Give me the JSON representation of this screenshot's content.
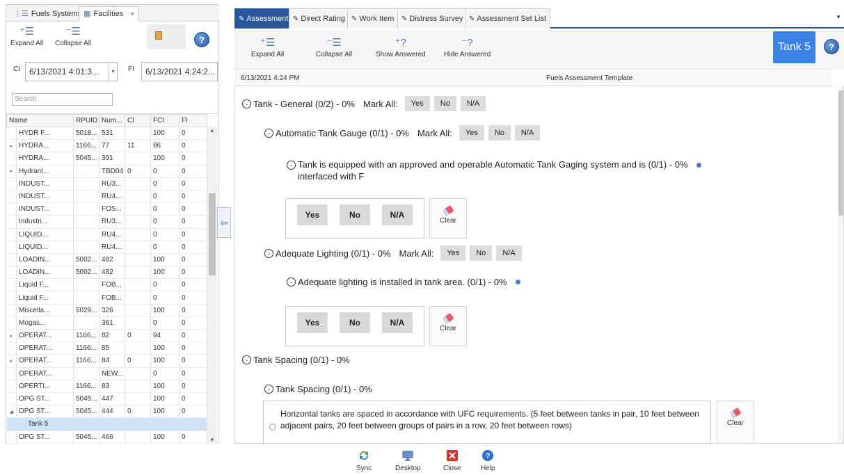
{
  "left_panel": {
    "tabs": [
      {
        "label": "Fuels Systems",
        "icon": "tree-icon"
      },
      {
        "label": "Facilities",
        "icon": "facility-icon",
        "close": "×"
      }
    ],
    "toolbar": {
      "expand_all": "Expand All",
      "collapse_all": "Collapse All"
    },
    "ci_label": "CI",
    "ci_value": "6/13/2021 4:01:3...",
    "fi_label": "FI",
    "fi_value": "6/13/2021 4:24:2...",
    "search_placeholder": "Search",
    "columns": [
      "Name",
      "RPUID",
      "Num...",
      "CI",
      "FCI",
      "FI"
    ],
    "rows": [
      {
        "exp": "",
        "name": "HYDR F...",
        "rpuid": "5018...",
        "num": "531",
        "ci": "",
        "fci": "100",
        "fi": "0"
      },
      {
        "exp": "▸",
        "name": "HYDRA...",
        "rpuid": "1166...",
        "num": "77",
        "ci": "11",
        "fci": "86",
        "fi": "0"
      },
      {
        "exp": "",
        "name": "HYDRA...",
        "rpuid": "5045...",
        "num": "391",
        "ci": "",
        "fci": "100",
        "fi": "0"
      },
      {
        "exp": "▸",
        "name": "Hydrant...",
        "rpuid": "",
        "num": "TBD04",
        "ci": "0",
        "fci": "0",
        "fi": "0"
      },
      {
        "exp": "",
        "name": "INDUST...",
        "rpuid": "",
        "num": "RU3...",
        "ci": "",
        "fci": "0",
        "fi": "0"
      },
      {
        "exp": "",
        "name": "INDUST...",
        "rpuid": "",
        "num": "RU4...",
        "ci": "",
        "fci": "0",
        "fi": "0"
      },
      {
        "exp": "",
        "name": "INDUST...",
        "rpuid": "",
        "num": "FOS...",
        "ci": "",
        "fci": "0",
        "fi": "0"
      },
      {
        "exp": "",
        "name": "Industri...",
        "rpuid": "",
        "num": "RU3...",
        "ci": "",
        "fci": "0",
        "fi": "0"
      },
      {
        "exp": "",
        "name": "LIQUID...",
        "rpuid": "",
        "num": "RU4...",
        "ci": "",
        "fci": "0",
        "fi": "0"
      },
      {
        "exp": "",
        "name": "LIQUID...",
        "rpuid": "",
        "num": "RU4...",
        "ci": "",
        "fci": "0",
        "fi": "0"
      },
      {
        "exp": "",
        "name": "LOADIN...",
        "rpuid": "5002...",
        "num": "482",
        "ci": "",
        "fci": "100",
        "fi": "0"
      },
      {
        "exp": "",
        "name": "LOADIN...",
        "rpuid": "5002...",
        "num": "482",
        "ci": "",
        "fci": "100",
        "fi": "0"
      },
      {
        "exp": "",
        "name": "Liquid F...",
        "rpuid": "",
        "num": "FOB...",
        "ci": "",
        "fci": "0",
        "fi": "0"
      },
      {
        "exp": "",
        "name": "Liquid F...",
        "rpuid": "",
        "num": "FOB...",
        "ci": "",
        "fci": "0",
        "fi": "0"
      },
      {
        "exp": "",
        "name": "Miscella...",
        "rpuid": "5029...",
        "num": "326",
        "ci": "",
        "fci": "100",
        "fi": "0"
      },
      {
        "exp": "",
        "name": "Mogas...",
        "rpuid": "",
        "num": "361",
        "ci": "",
        "fci": "0",
        "fi": "0"
      },
      {
        "exp": "▸",
        "name": "OPERAT...",
        "rpuid": "1166...",
        "num": "82",
        "ci": "0",
        "fci": "94",
        "fi": "0"
      },
      {
        "exp": "",
        "name": "OPERAT...",
        "rpuid": "1166...",
        "num": "85",
        "ci": "",
        "fci": "100",
        "fi": "0"
      },
      {
        "exp": "▸",
        "name": "OPERAT...",
        "rpuid": "1166...",
        "num": "84",
        "ci": "0",
        "fci": "100",
        "fi": "0"
      },
      {
        "exp": "",
        "name": "OPERAT...",
        "rpuid": "",
        "num": "NEW...",
        "ci": "",
        "fci": "0",
        "fi": "0"
      },
      {
        "exp": "",
        "name": "OPERTI...",
        "rpuid": "1166...",
        "num": "83",
        "ci": "",
        "fci": "100",
        "fi": "0"
      },
      {
        "exp": "",
        "name": "OPG ST...",
        "rpuid": "5045...",
        "num": "447",
        "ci": "",
        "fci": "100",
        "fi": "0"
      },
      {
        "exp": "◢",
        "name": "OPG ST...",
        "rpuid": "5045...",
        "num": "444",
        "ci": "0",
        "fci": "100",
        "fi": "0"
      },
      {
        "exp": "",
        "name": "Tank 5",
        "rpuid": "",
        "num": "",
        "ci": "",
        "fci": "",
        "fi": "",
        "child": true,
        "selected": true
      },
      {
        "exp": "",
        "name": "OPG ST...",
        "rpuid": "5045...",
        "num": "466",
        "ci": "",
        "fci": "100",
        "fi": "0"
      }
    ]
  },
  "right_panel": {
    "tabs": [
      "Assessment",
      "Direct Rating",
      "Work Item",
      "Distress Survey",
      "Assessment Set List"
    ],
    "toolbar": {
      "expand_all": "Expand All",
      "collapse_all": "Collapse All",
      "show_answered": "Show Answered",
      "hide_answered": "Hide Answered",
      "current_item": "Tank 5"
    },
    "info_date": "6/13/2021 4:24 PM",
    "info_template": "Fuels Assessment Template",
    "mark_all": "Mark All:",
    "answers": {
      "yes": "Yes",
      "no": "No",
      "na": "N/A",
      "clear": "Clear"
    },
    "sections": {
      "tank_general": "Tank - General (0/2) - 0%",
      "auto_tank_gauge": "Automatic Tank Gauge (0/1) - 0%",
      "q_atg_line1": "Tank is equipped with an approved and operable Automatic Tank Gaging system and is",
      "q_atg_line2": "interfaced with F",
      "q_atg_score": "(0/1) - 0%",
      "adequate_lighting": "Adequate Lighting (0/1) - 0%",
      "q_lighting": "Adequate lighting is installed in tank area. (0/1) - 0%",
      "tank_spacing": "Tank Spacing (0/1) - 0%",
      "tank_spacing_sub": "Tank Spacing (0/1) - 0%",
      "q_spacing": "Horizontal tanks are spaced in accordance with UFC requirements. (5 feet between tanks in pair, 10 feet between adjacent pairs, 20 feet between groups of pairs in a row, 20 feet between rows)"
    }
  },
  "bottom_bar": {
    "sync": "Sync",
    "desktop": "Desktop",
    "close": "Close",
    "help": "Help"
  },
  "colors": {
    "accent": "#2b579a",
    "tank_button": "#3b82e6",
    "selected_row": "#cfe4f7",
    "close_red": "#d9312b"
  }
}
